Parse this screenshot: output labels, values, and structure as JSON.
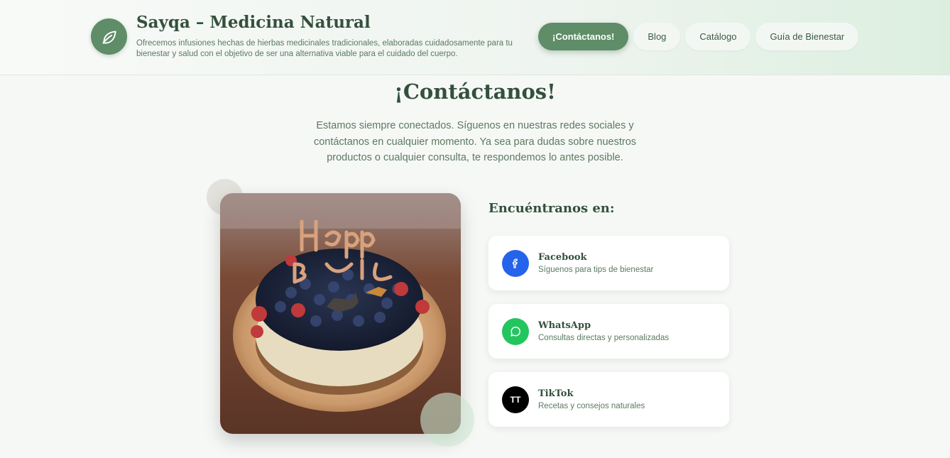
{
  "header": {
    "title": "Sayqa – Medicina Natural",
    "description": "Ofrecemos infusiones hechas de hierbas medicinales tradicionales, elaboradas cuidadosamente para tu bienestar y salud con el objetivo de ser una alternativa viable para el cuidado del cuerpo.",
    "logo_icon": "leaf-icon",
    "nav": [
      {
        "label": "¡Contáctanos!",
        "active": true
      },
      {
        "label": "Blog",
        "active": false
      },
      {
        "label": "Catálogo",
        "active": false
      },
      {
        "label": "Guía de Bienestar",
        "active": false
      }
    ]
  },
  "main": {
    "title": "¡Contáctanos!",
    "intro": "Estamos siempre conectados. Síguenos en nuestras redes sociales y contáctanos en cualquier momento. Ya sea para dudas sobre nuestros productos o cualquier consulta, te respondemos lo antes posible.",
    "image_icon": "birthday-cake-photo",
    "find_title": "Encuéntranos en:"
  },
  "social": [
    {
      "name": "Facebook",
      "subtitle": "Síguenos para tips de bienestar",
      "icon": "facebook-icon",
      "color": "#2563eb"
    },
    {
      "name": "WhatsApp",
      "subtitle": "Consultas directas y personalizadas",
      "icon": "whatsapp-icon",
      "color": "#22c55e"
    },
    {
      "name": "TikTok",
      "subtitle": "Recetas y consejos naturales",
      "icon": "tiktok-icon",
      "color": "#000000",
      "icon_text": "TT"
    }
  ],
  "colors": {
    "primary": "#5e8d68",
    "title": "#34503c",
    "text": "#5b7a62",
    "background": "#f6f8f6"
  }
}
